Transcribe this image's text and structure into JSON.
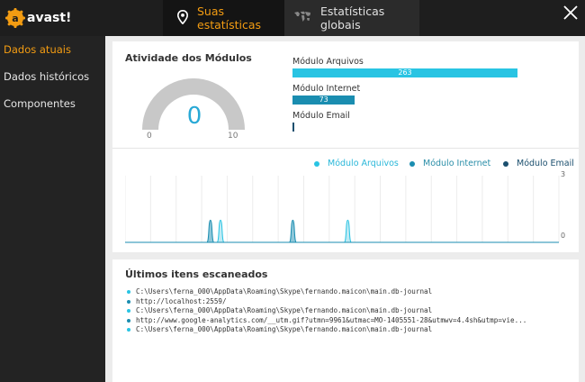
{
  "app": {
    "logo_text": "avast!"
  },
  "tabs": [
    {
      "label": "Suas estatísticas",
      "active": true
    },
    {
      "label": "Estatísticas globais",
      "active": false
    }
  ],
  "sidebar": {
    "items": [
      {
        "label": "Dados atuais",
        "active": true
      },
      {
        "label": "Dados históricos",
        "active": false
      },
      {
        "label": "Componentes",
        "active": false
      }
    ]
  },
  "activity": {
    "title": "Atividade dos Módulos",
    "gauge": {
      "value": "0",
      "min": "0",
      "max": "10"
    },
    "modules": [
      {
        "label": "Módulo Arquivos",
        "value": "263",
        "count": 263,
        "color": "#29c4e3"
      },
      {
        "label": "Módulo Internet",
        "value": "73",
        "count": 73,
        "color": "#1a8db0"
      },
      {
        "label": "Módulo Email",
        "value": "",
        "count": 0,
        "color": "#1b4f6e"
      }
    ]
  },
  "colors": {
    "accent": "#f39c12",
    "arquivos": "#29c4e3",
    "internet": "#1a8db0",
    "email": "#1b4f6e"
  },
  "chart_data": {
    "type": "area",
    "series": [
      {
        "name": "Módulo Arquivos",
        "spikes": [
          {
            "x": 6.6,
            "y": 1
          },
          {
            "x": 15.4,
            "y": 1
          }
        ]
      },
      {
        "name": "Módulo Internet",
        "spikes": [
          {
            "x": 5.9,
            "y": 1
          },
          {
            "x": 11.6,
            "y": 1
          }
        ]
      },
      {
        "name": "Módulo Email",
        "spikes": []
      }
    ],
    "ylim": [
      0,
      3
    ],
    "y_tick_labels": [
      "3",
      "0"
    ],
    "x_range": [
      0,
      30
    ],
    "grid": true,
    "legend_position": "top-right"
  },
  "scanned": {
    "title": "Últimos itens escaneados",
    "items": [
      {
        "text": "C:\\Users\\ferna_000\\AppData\\Roaming\\Skype\\fernando.maicon\\main.db-journal",
        "color": "#29c4e3"
      },
      {
        "text": "http://localhost:2559/",
        "color": "#1a8db0"
      },
      {
        "text": "C:\\Users\\ferna_000\\AppData\\Roaming\\Skype\\fernando.maicon\\main.db-journal",
        "color": "#29c4e3"
      },
      {
        "text": "http://www.google-analytics.com/__utm.gif?utmn=9961&utmac=MO-1405551-28&utmwv=4.4sh&utmp=vie...",
        "color": "#1a8db0"
      },
      {
        "text": "C:\\Users\\ferna_000\\AppData\\Roaming\\Skype\\fernando.maicon\\main.db-journal",
        "color": "#29c4e3"
      }
    ]
  }
}
